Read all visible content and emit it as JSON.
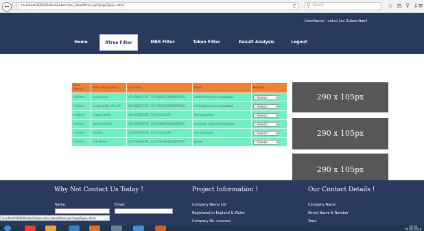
{
  "browser": {
    "url": "localhost:8080/PublishSubscriber_New/Rtree.jsp?pageType=rtree",
    "search_placeholder": "Search",
    "back_glyph": "←",
    "info_glyph": "ⓘ",
    "reload_glyph": "C",
    "search_glyph": "⚲",
    "toolbar_icons": [
      "☆",
      "⊟",
      "⊽",
      "⇓",
      "⌂",
      "☻",
      "≡"
    ]
  },
  "header": {
    "user_label": "UserName : rahul (as Subscriber)",
    "nav": [
      {
        "label": "Home"
      },
      {
        "label": "RTree Filter"
      },
      {
        "label": "MBR Filter"
      },
      {
        "label": "Token Filter"
      },
      {
        "label": "Result Analysis"
      },
      {
        "label": "Logout"
      }
    ]
  },
  "table": {
    "headers": [
      "Item Name",
      "Item Description",
      "Location",
      "Place",
      "Review"
    ],
    "rows": [
      {
        "name": "t-shirts",
        "desc": "polo neck",
        "location": "(19.8811705, 75.30202389999992)",
        "place": "chikalthana,Aurangabad",
        "review": "--Select--"
      },
      {
        "name": "t-shirts",
        "desc": "collar with slim fit",
        "location": "(19.8811705, 75.30202389999992)",
        "place": "chikalthana,Aurangabad",
        "review": "--Select--"
      },
      {
        "name": "t-shirts",
        "desc": "round neck",
        "location": "(19.8761653, 75.3433139)",
        "place": "Aurangabad",
        "review": "--Select--"
      },
      {
        "name": "t-shirts",
        "desc": "sport tshirts",
        "location": "(19.8921876, 75.36680500000003)",
        "place": "prozone mall,Aurangabad",
        "review": "--Select--"
      },
      {
        "name": "t-shirts",
        "desc": "cotton",
        "location": "(19.8761653, 75.3433139)",
        "place": "Aurangabad",
        "review": "--Select--"
      },
      {
        "name": "t-shirts",
        "desc": "full sleve",
        "location": "(18.5204303, 73.85674360000002)",
        "place": "pune",
        "review": "--Select--"
      }
    ]
  },
  "ads": [
    "290 x 105px",
    "290 x 105px",
    "290 x 105px"
  ],
  "footer": {
    "contact_title": "Why Not Contact Us Today !",
    "name_label": "Name:",
    "email_label": "Email:",
    "project_title": "Project Information !",
    "project_lines": [
      "Company Name Ltd",
      "Registered in England & Wales",
      "Company No. xxxxxxx"
    ],
    "details_title": "Our Contact Details !",
    "details_lines": [
      "Company Name",
      "Street Name & Number",
      "Town"
    ]
  },
  "status_bar": "localhost:8080/PublishSubscriber_New/Rtree.jsp?pageType=rtree",
  "taskbar": {
    "clock_time": "10:34",
    "clock_date": "01-05-2016",
    "app_colors": [
      "#e8412c",
      "#e8a33c",
      "#3a7fc0",
      "#e07020",
      "#6a7f95",
      "#3c8fd8",
      "#d05a2a"
    ]
  }
}
